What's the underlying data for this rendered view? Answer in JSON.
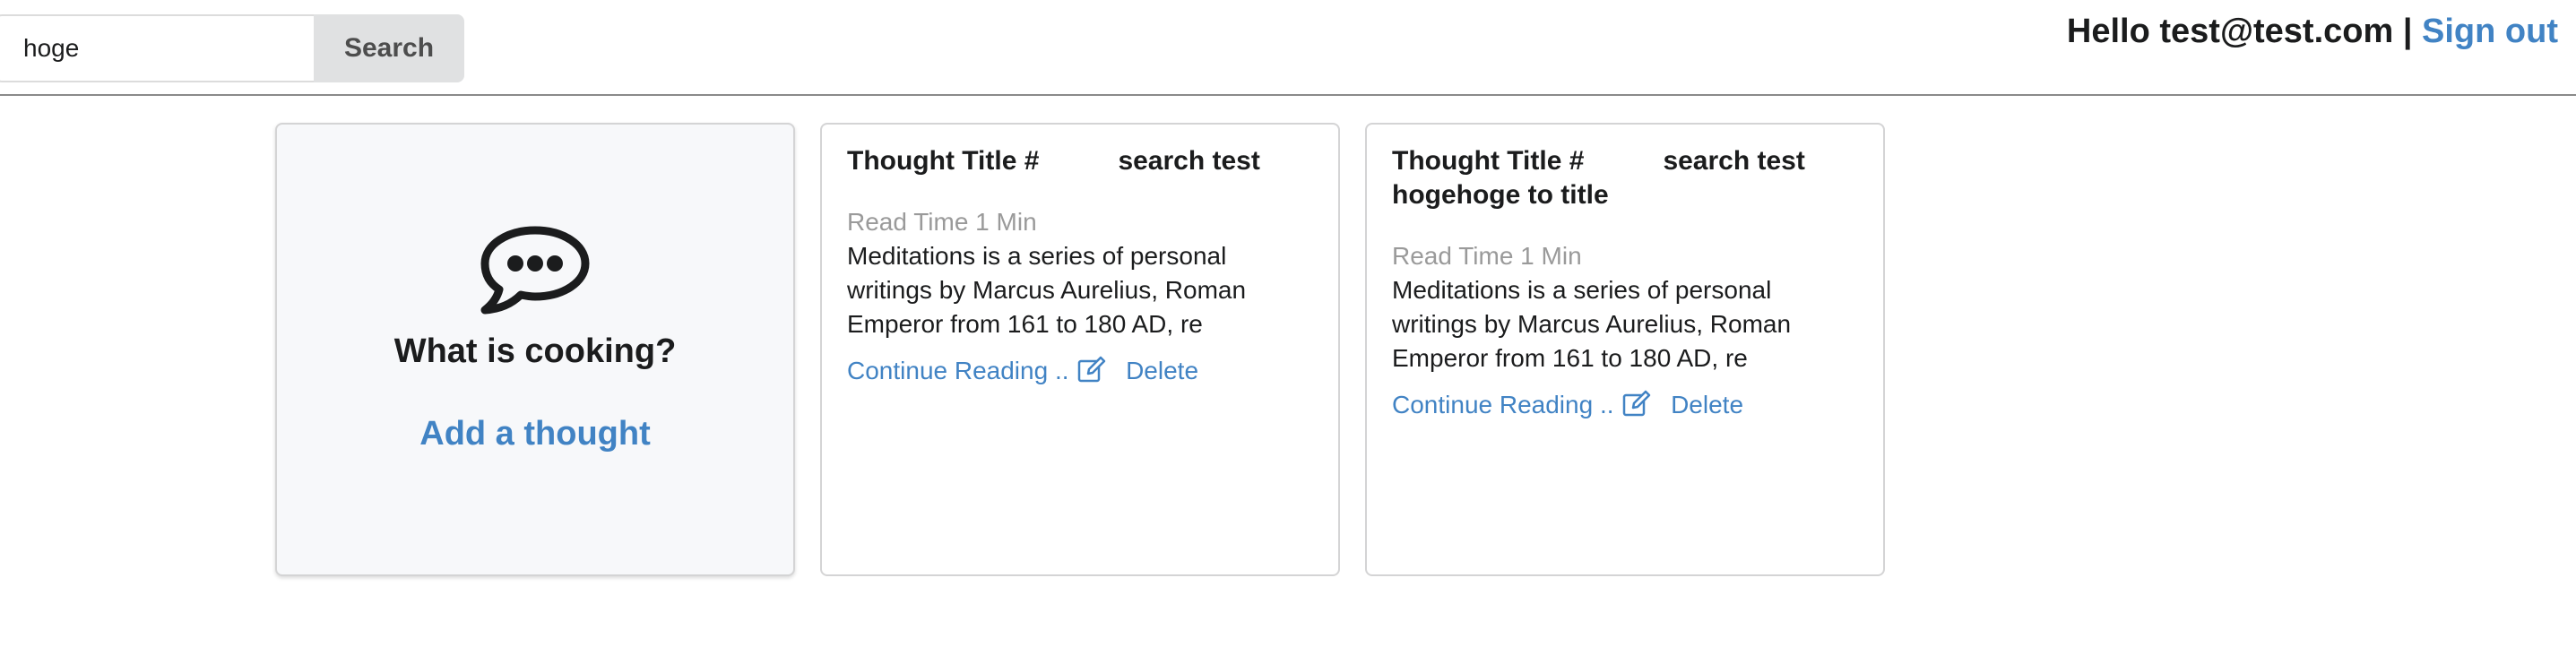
{
  "header": {
    "search_value": "hoge",
    "search_button": "Search",
    "greeting_prefix": "Hello test@test.com |",
    "sign_out": "Sign out"
  },
  "add_card": {
    "icon": "speech-bubble-icon",
    "title": "What is cooking?",
    "link": "Add a thought"
  },
  "thoughts": [
    {
      "title_prefix": "Thought Title #",
      "title_rest": "search test",
      "read_time": "Read Time 1 Min",
      "excerpt": "Meditations is a series of personal writings by Marcus Aurelius, Roman Emperor from 161 to 180 AD, re",
      "continue": "Continue Reading ..",
      "delete": "Delete"
    },
    {
      "title_prefix": "Thought Title #",
      "title_rest": "search test hogehoge to title",
      "read_time": "Read Time 1 Min",
      "excerpt": "Meditations is a series of personal writings by Marcus Aurelius, Roman Emperor from 161 to 180 AD, re",
      "continue": "Continue Reading ..",
      "delete": "Delete"
    }
  ],
  "colors": {
    "link": "#4183c4",
    "muted": "#9a9a9a",
    "button_bg": "#e0e1e2"
  }
}
